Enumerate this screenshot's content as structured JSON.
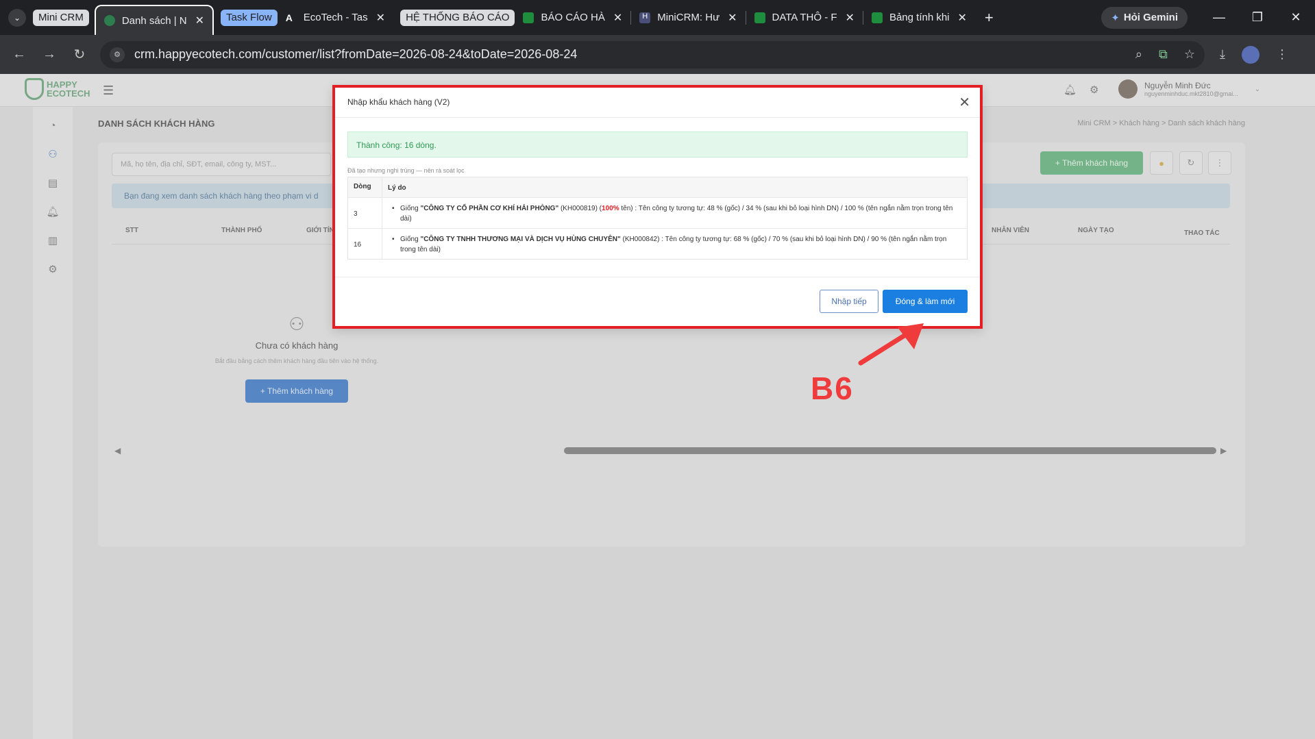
{
  "browser": {
    "group1": "Mini CRM",
    "tabs": [
      {
        "label": "Danh sách | N",
        "active": true
      },
      {
        "label": "EcoTech - Tas"
      },
      {
        "label": "BÁO CÁO HÀ"
      },
      {
        "label": "MiniCRM: Hư"
      },
      {
        "label": "DATA THÔ - F"
      },
      {
        "label": "Bảng tính khi"
      }
    ],
    "group2": "Task Flow",
    "group3": "HỆ THỐNG BÁO CÁO",
    "gemini": "Hỏi Gemini",
    "url": "crm.happyecotech.com/customer/list?fromDate=2026-08-24&toDate=2026-08-24"
  },
  "app": {
    "logo": [
      "HAPPY",
      "ECOTECH"
    ],
    "user_name": "Nguyễn Minh Đức",
    "user_email": "nguyenminhduc.mkt2810@gmai...",
    "page_title": "DANH SÁCH KHÁCH HÀNG",
    "breadcrumb": "Mini CRM  >  Khách hàng  >  Danh sách khách hàng",
    "search_placeholder": "Mã, họ tên, địa chỉ, SĐT, email, công ty, MST...",
    "add_button": "+  Thêm khách hàng",
    "info_bar": "Bạn đang xem danh sách khách hàng theo phạm vi d",
    "columns": [
      "STT",
      "THÀNH PHỐ",
      "GIỚI TÍN",
      "NHÂN VIÊN",
      "NGÀY TẠO",
      "THAO TÁC"
    ],
    "empty_title": "Chưa có khách hàng",
    "empty_sub": "Bắt đầu bằng cách thêm khách hàng đầu tiên vào hệ thống.",
    "empty_button": "+  Thêm khách hàng"
  },
  "modal": {
    "title": "Nhập khẩu khách hàng (V2)",
    "success_prefix": "Thành công: ",
    "success_count": "16",
    "success_suffix": " dòng.",
    "note": "Đã tạo nhưng nghi trùng — nên rà soát lọc",
    "col_line": "Dòng",
    "col_reason": "Lý do",
    "rows": [
      {
        "line": "3",
        "pre": "Giống ",
        "name": "\"CÔNG TY CỔ PHẦN CƠ KHÍ HẢI PHÒNG\"",
        "code": " (KH000819) (",
        "pct": "100%",
        "rest": " tên) : Tên công ty tương tự: 48 % (gốc) / 34 % (sau khi bỏ loại hình DN) / 100 % (tên ngắn nằm trọn trong tên dài)"
      },
      {
        "line": "16",
        "pre": "Giống ",
        "name": "\"CÔNG TY TNHH THƯƠNG MẠI VÀ DỊCH VỤ HÙNG CHUYÊN\"",
        "code": " (KH000842) : Tên công ty tương tự: 68 % (gốc) / 70 % (sau khi bỏ loại hình DN) / 90 % (tên ngắn nằm trọn trong tên dài)",
        "pct": "",
        "rest": ""
      }
    ],
    "btn_next": "Nhập tiếp",
    "btn_close": "Đóng & làm mới"
  },
  "annotation": {
    "step_label": "B6",
    "color": "#ef3b3b"
  }
}
